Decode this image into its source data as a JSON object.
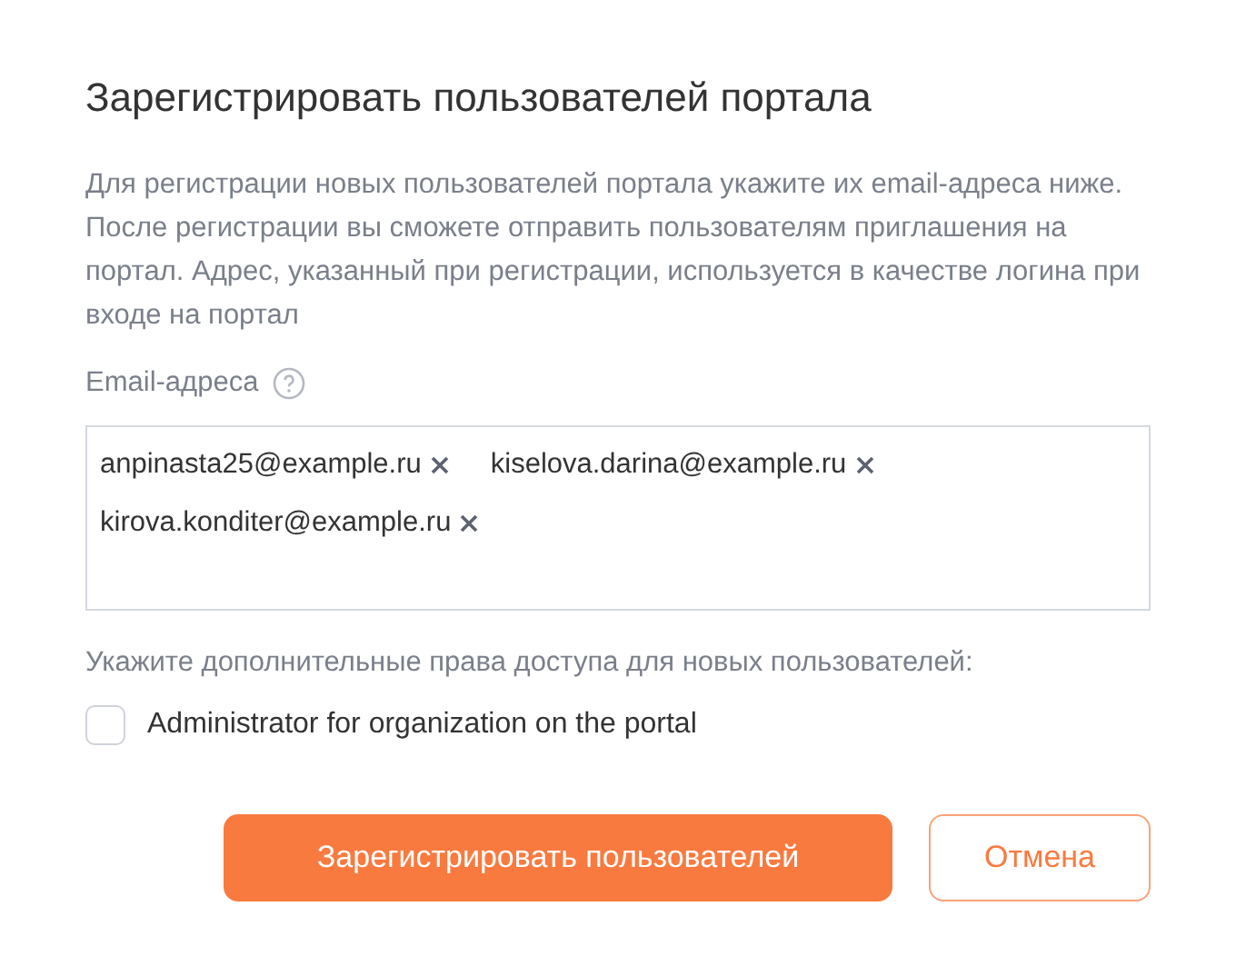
{
  "dialog": {
    "title": "Зарегистрировать пользователей портала",
    "description": "Для регистрации новых пользователей портала укажите их email-адреса ниже. После регистрации вы сможете отправить пользователям приглашения на портал. Адрес, указанный при регистрации, используется в качестве логина при входе на портал",
    "email_field": {
      "label": "Email-адреса",
      "emails": [
        "anpinasta25@example.ru",
        "kiselova.darina@example.ru",
        "kirova.konditer@example.ru"
      ]
    },
    "rights_label": "Укажите дополнительные права доступа для новых пользователей:",
    "checkboxes": [
      {
        "label": "Administrator for organization on the portal",
        "checked": false
      }
    ],
    "buttons": [
      {
        "label": "Зарегистрировать пользователей",
        "kind": "primary"
      },
      {
        "label": "Отмена",
        "kind": "secondary"
      }
    ]
  }
}
